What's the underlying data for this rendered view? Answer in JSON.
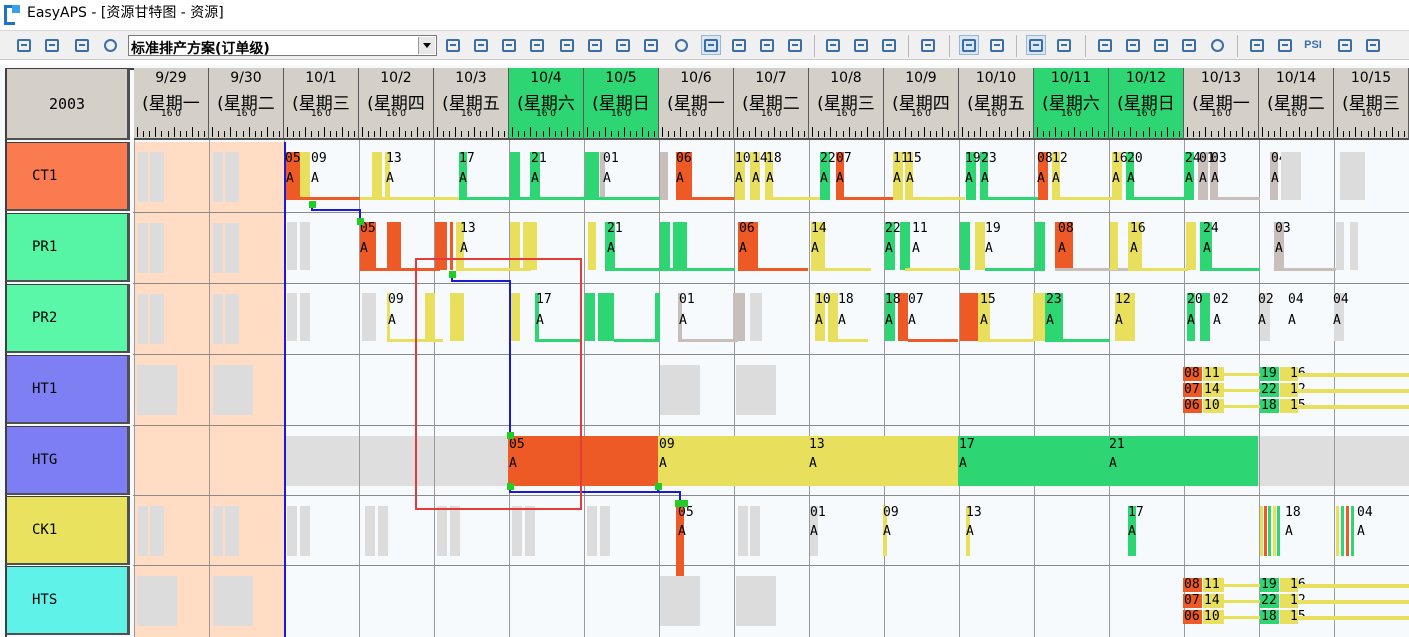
{
  "window": {
    "title": "EasyAPS - [资源甘特图 - 资源]",
    "logo_icon": "easyaps-logo-icon"
  },
  "toolbar": {
    "plan_select_value": "标准排产方案(订单级)",
    "psi_label": "PSI",
    "icon_color": "#3a6ea8"
  },
  "gantt": {
    "year": "2003",
    "hour_ticks": "16  0",
    "colors": {
      "weekday_header": "#d4d0c8",
      "weekend_header": "#2ed673",
      "frozen_zone": "#ffdcc3",
      "order_05": "#ee5a26",
      "order_09_13": "#e8e05c",
      "order_17_21": "#2ed673",
      "order_grey": "#c8bfbb",
      "link_line": "#1a1ad0",
      "highlight_box": "#e53a3a"
    },
    "days": [
      {
        "date": "9/29",
        "dow": "(星期一",
        "weekend": false
      },
      {
        "date": "9/30",
        "dow": "(星期二",
        "weekend": false
      },
      {
        "date": "10/1",
        "dow": "(星期三",
        "weekend": false
      },
      {
        "date": "10/2",
        "dow": "(星期四",
        "weekend": false
      },
      {
        "date": "10/3",
        "dow": "(星期五",
        "weekend": false
      },
      {
        "date": "10/4",
        "dow": "(星期六",
        "weekend": true
      },
      {
        "date": "10/5",
        "dow": "(星期日",
        "weekend": true
      },
      {
        "date": "10/6",
        "dow": "(星期一",
        "weekend": false
      },
      {
        "date": "10/7",
        "dow": "(星期二",
        "weekend": false
      },
      {
        "date": "10/8",
        "dow": "(星期三",
        "weekend": false
      },
      {
        "date": "10/9",
        "dow": "(星期四",
        "weekend": false
      },
      {
        "date": "10/10",
        "dow": "(星期五",
        "weekend": false
      },
      {
        "date": "10/11",
        "dow": "(星期六",
        "weekend": true
      },
      {
        "date": "10/12",
        "dow": "(星期日",
        "weekend": true
      },
      {
        "date": "10/13",
        "dow": "(星期一",
        "weekend": false
      },
      {
        "date": "10/14",
        "dow": "(星期二",
        "weekend": false
      },
      {
        "date": "10/15",
        "dow": "(星期三",
        "weekend": false
      }
    ],
    "resources": [
      {
        "name": "CT1",
        "color": "#f97b4f"
      },
      {
        "name": "PR1",
        "color": "#56f5a4"
      },
      {
        "name": "PR2",
        "color": "#5bf7a8"
      },
      {
        "name": "HT1",
        "color": "#7f7ff4"
      },
      {
        "name": "HTG",
        "color": "#7e7ef4"
      },
      {
        "name": "CK1",
        "color": "#e9e25f"
      },
      {
        "name": "HTS",
        "color": "#5ef2e8"
      }
    ],
    "task_labels": {
      "ct1": [
        "05",
        "09",
        "13",
        "17",
        "21",
        "01",
        "06",
        "10",
        "14",
        "18",
        "22",
        "07",
        "11",
        "15",
        "19",
        "23",
        "08",
        "12",
        "16",
        "20",
        "24",
        "01",
        "03",
        "04"
      ],
      "pr1": [
        "05",
        "13",
        "21",
        "06",
        "14",
        "22",
        "11",
        "19",
        "08",
        "16",
        "24",
        "03"
      ],
      "pr2": [
        "09",
        "17",
        "01",
        "10",
        "18",
        "18",
        "07",
        "15",
        "23",
        "12",
        "20",
        "02",
        "02",
        "04",
        "04"
      ],
      "ht1": [
        "08",
        "11",
        "07",
        "14",
        "06",
        "10",
        "19",
        "16",
        "22",
        "12",
        "18",
        "15"
      ],
      "htg": [
        "05",
        "09",
        "13",
        "17",
        "21"
      ],
      "ck1": [
        "05",
        "01",
        "09",
        "13",
        "17",
        "18",
        "04"
      ],
      "hts": [
        "08",
        "11",
        "07",
        "14",
        "06",
        "10",
        "19",
        "16",
        "22",
        "12",
        "18",
        "15"
      ]
    },
    "grade_label": "A"
  }
}
